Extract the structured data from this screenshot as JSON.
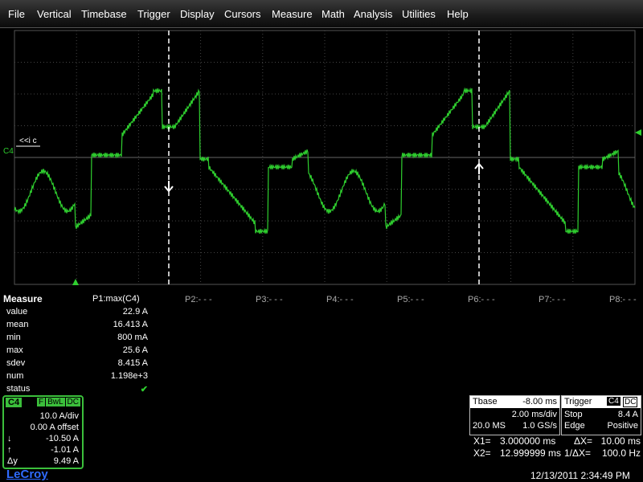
{
  "menu": [
    "File",
    "Vertical",
    "Timebase",
    "Trigger",
    "Display",
    "Cursors",
    "Measure",
    "Math",
    "Analysis",
    "Utilities",
    "Help"
  ],
  "trace": {
    "channel_label": "C4",
    "annotation": "<<i c",
    "color": "#2fcf2f"
  },
  "measure": {
    "title": "Measure",
    "param_header": "P1:max(C4)",
    "p_labels": [
      "P2:- - -",
      "P3:- - -",
      "P4:- - -",
      "P5:- - -",
      "P6:- - -",
      "P7:- - -",
      "P8:- - -"
    ],
    "rows": [
      {
        "label": "value",
        "value": "22.9 A"
      },
      {
        "label": "mean",
        "value": "16.413 A"
      },
      {
        "label": "min",
        "value": "800 mA"
      },
      {
        "label": "max",
        "value": "25.6 A"
      },
      {
        "label": "sdev",
        "value": "8.415 A"
      },
      {
        "label": "num",
        "value": "1.198e+3"
      },
      {
        "label": "status",
        "value": "✔"
      }
    ]
  },
  "channel": {
    "tag": "C4",
    "flags": [
      "F",
      "BwL",
      "DC"
    ],
    "vdiv": "10.0 A/div",
    "offset": "0.00 A offset",
    "cursor1": "-10.50 A",
    "cursor2": "-1.01 A",
    "delta": "9.49 A",
    "cursor1_sym": "↓",
    "cursor2_sym": "↑",
    "delta_sym": "Δy"
  },
  "timebase": {
    "title": "Tbase",
    "delay": "-8.00 ms",
    "tdiv": "2.00 ms/div",
    "samples": "20.0 MS",
    "rate": "1.0 GS/s"
  },
  "trigger": {
    "title": "Trigger",
    "channel": "C4",
    "coupling": "DC",
    "mode": "Stop",
    "level": "8.4 A",
    "type": "Edge",
    "slope": "Positive"
  },
  "cursors": {
    "x1_label": "X1=",
    "x1": "3.000000 ms",
    "dx_label": "ΔX=",
    "dx": "10.00 ms",
    "x2_label": "X2=",
    "x2": "12.999999 ms",
    "inv_label": "1/ΔX=",
    "inv": "100.0 Hz"
  },
  "brand": "LeCroy",
  "datetime": "12/13/2011 2:34:49 PM"
}
